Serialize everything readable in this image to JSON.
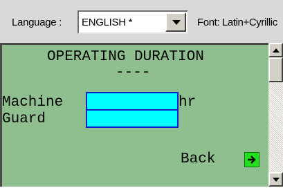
{
  "toolbar": {
    "language_label": "Language :",
    "language_value": "ENGLISH *",
    "font_label": "Font: Latin+Cyrillic"
  },
  "display": {
    "title": "OPERATING DURATION",
    "dashes": "----",
    "machine_label": "Machine",
    "machine_value": "",
    "machine_suffix": "hr",
    "guard_label": "Guard",
    "guard_value": "",
    "back_label": "Back",
    "back_icon": "green-arrow-icon"
  },
  "colors": {
    "display_bg": "#8fbf8e",
    "field_bg": "#00ffff",
    "field_border": "#0b22c9",
    "back_icon_bg": "#22e01e"
  }
}
